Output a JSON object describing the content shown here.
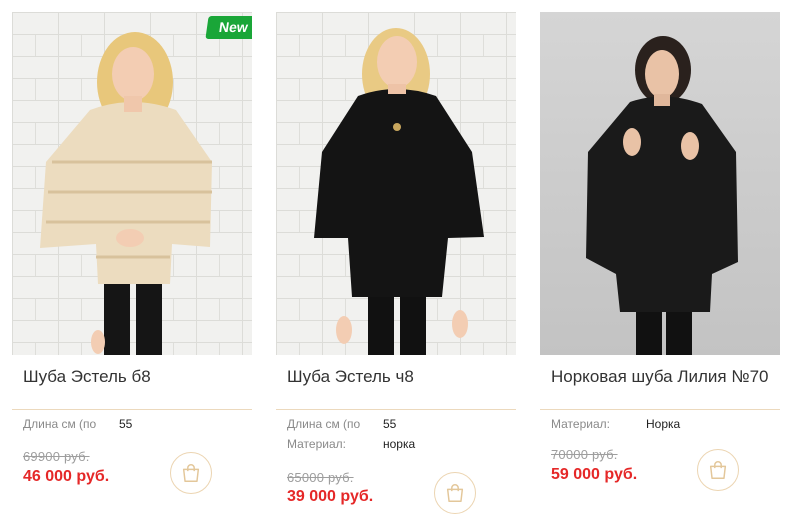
{
  "products": [
    {
      "title": "Шуба Эстель б8",
      "badge": "New",
      "props": [
        {
          "label": "Длина см (по",
          "value": "55"
        }
      ],
      "old_price": "69900 руб.",
      "new_price": "46 000 руб.",
      "coat_color": "#ecdcbf"
    },
    {
      "title": "Шуба Эстель ч8",
      "props": [
        {
          "label": "Длина см (по",
          "value": "55"
        },
        {
          "label": "Материал:",
          "value": "норка"
        }
      ],
      "old_price": "65000 руб.",
      "new_price": "39 000 руб.",
      "coat_color": "#141414"
    },
    {
      "title": "Норковая шуба Лилия №70",
      "props": [
        {
          "label": "Материал:",
          "value": "Норка"
        }
      ],
      "old_price": "70000 руб.",
      "new_price": "59 000 руб.",
      "coat_color": "#1a1a1a"
    }
  ],
  "colors": {
    "accent_red": "#e52828",
    "badge_green": "#1aa638",
    "cart_stroke": "#e3c79a",
    "divider": "#ecd9bd"
  }
}
